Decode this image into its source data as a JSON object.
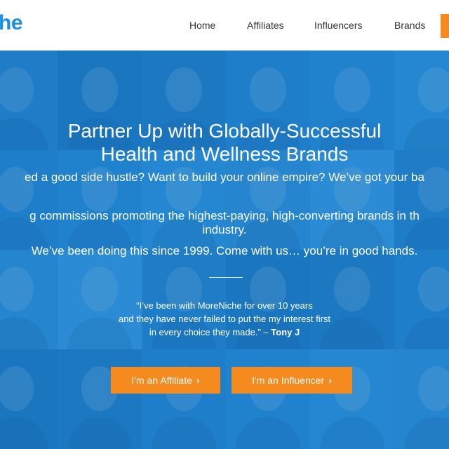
{
  "header": {
    "logo_text": "he",
    "nav": [
      {
        "label": "Home"
      },
      {
        "label": "Affiliates"
      },
      {
        "label": "Influencers"
      },
      {
        "label": "Brands"
      }
    ]
  },
  "hero": {
    "title_lines": [
      "Partner Up with Globally-Successful",
      "Health and Wellness Brands"
    ],
    "lead_1": "ed a good side hustle? Want to build your online empire? We’ve got your ba",
    "lead_2a": "g commissions promoting the highest-paying, high-converting brands in th",
    "lead_2b": "industry.",
    "lead_3": "We’ve been doing this since 1999. Come with us… you’re in good hands.",
    "quote_lines": [
      "“I’ve been with MoreNiche for over 10 years",
      "and they have never failed to put the my interest first",
      "in every choice they made.”"
    ],
    "quote_dash": " – ",
    "quote_author": "Tony J",
    "buttons": {
      "affiliate": "I'm an Affiliate",
      "influencer": "I'm an Influencer",
      "chevron_icon": "chevron-right-icon"
    }
  },
  "colors": {
    "brand_blue": "#1a8fe0",
    "accent_orange": "#f58a1f",
    "hero_overlay": "#1884d6"
  }
}
